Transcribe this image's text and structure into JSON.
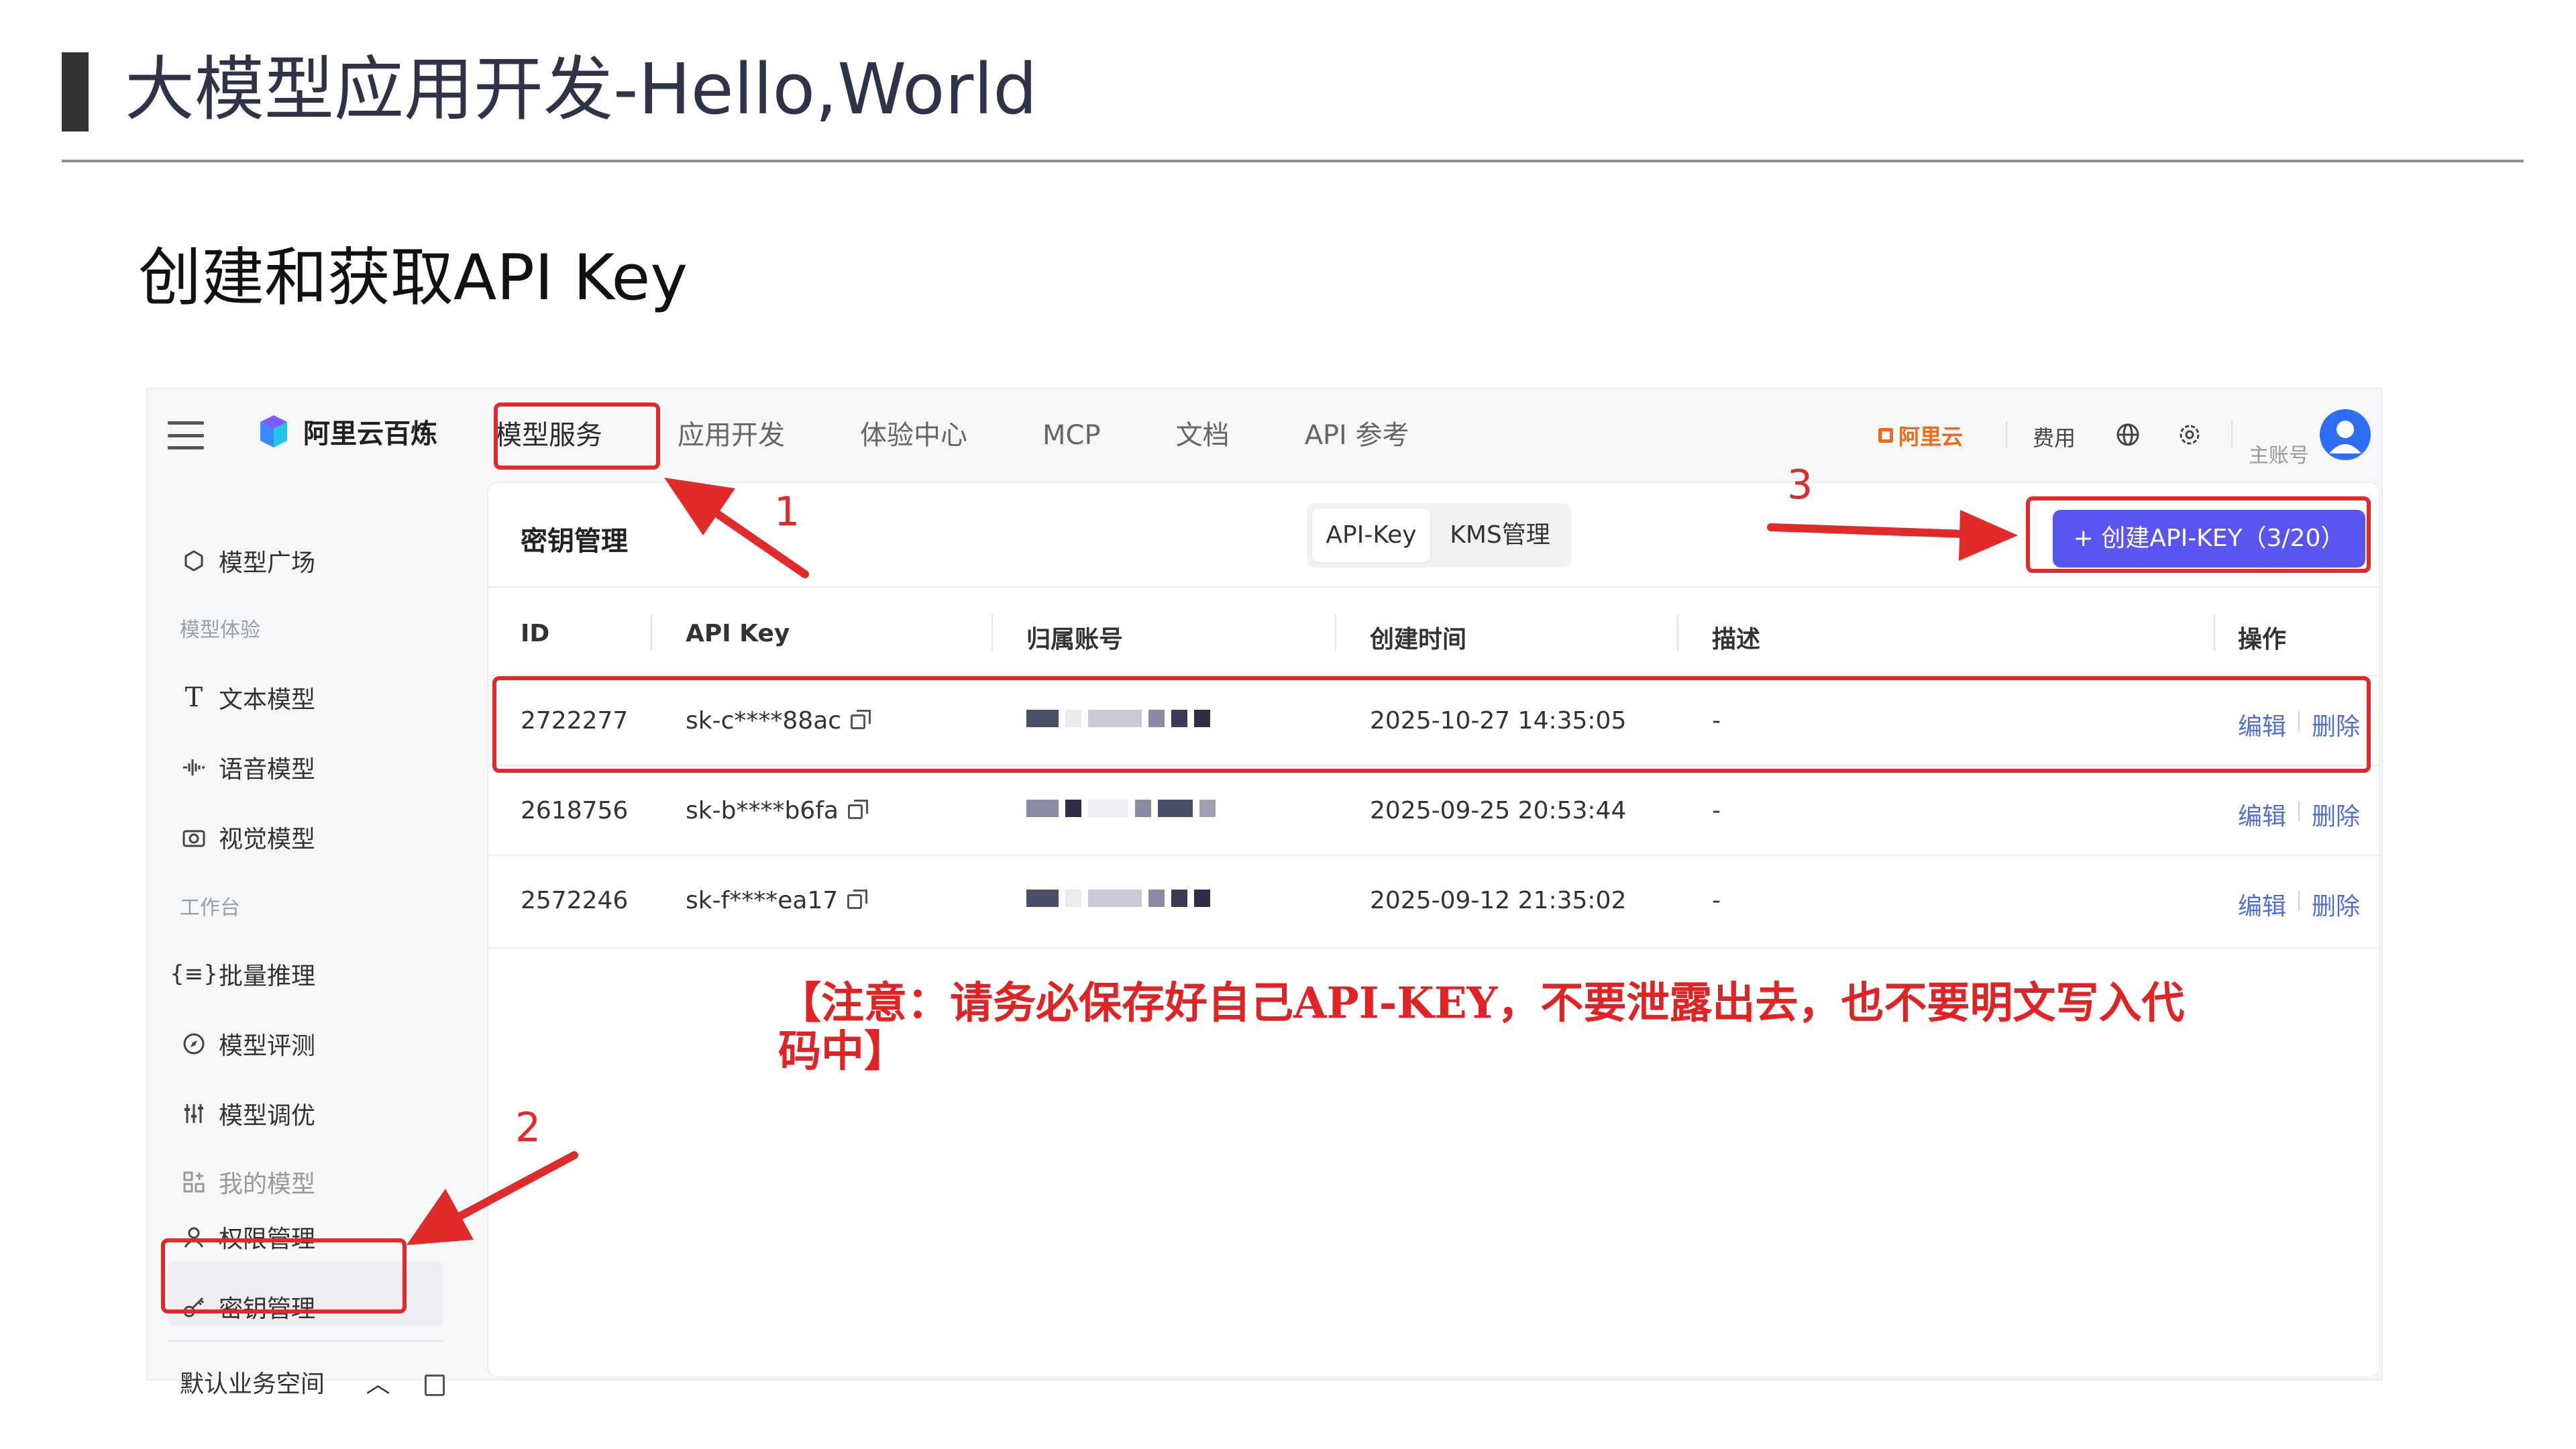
{
  "slide": {
    "title": "大模型应用开发-Hello,World",
    "subtitle": "创建和获取API Key"
  },
  "app": {
    "brand": "阿里云百炼",
    "nav": [
      "模型服务",
      "应用开发",
      "体验中心",
      "MCP",
      "文档",
      "API 参考"
    ],
    "active_nav": "模型服务",
    "aliyun_logo": "阿里云",
    "fee": "费用",
    "account_label": "主账号"
  },
  "sidebar": {
    "model_square": "模型广场",
    "group_experience": "模型体验",
    "text_model": "文本模型",
    "voice_model": "语音模型",
    "vision_model": "视觉模型",
    "group_workbench": "工作台",
    "batch_infer": "批量推理",
    "model_eval": "模型评测",
    "model_tune": "模型调优",
    "my_models": "我的模型",
    "permission": "权限管理",
    "key_manage": "密钥管理",
    "workspace": "默认业务空间"
  },
  "panel": {
    "title": "密钥管理",
    "tabs": [
      "API-Key",
      "KMS管理"
    ],
    "create_button": "+ 创建API-KEY（3/20）",
    "columns": [
      "ID",
      "API Key",
      "归属账号",
      "创建时间",
      "描述",
      "操作"
    ],
    "rows": [
      {
        "id": "2722277",
        "api_key": "sk-c****88ac",
        "created": "2025-10-27 14:35:05",
        "desc": "-",
        "edit": "编辑",
        "delete": "删除"
      },
      {
        "id": "2618756",
        "api_key": "sk-b****b6fa",
        "created": "2025-09-25 20:53:44",
        "desc": "-",
        "edit": "编辑",
        "delete": "删除"
      },
      {
        "id": "2572246",
        "api_key": "sk-f****ea17",
        "created": "2025-09-12 21:35:02",
        "desc": "-",
        "edit": "编辑",
        "delete": "删除"
      }
    ]
  },
  "notice": "【注意：请务必保存好自己API-KEY，不要泄露出去，也不要明文写入代码中】",
  "annotations": [
    "1",
    "2",
    "3"
  ],
  "colors": {
    "accent": "#5a55f0",
    "annotation": "#e12a2a",
    "link": "#4f6ed8",
    "brand_orange": "#f06a16"
  }
}
